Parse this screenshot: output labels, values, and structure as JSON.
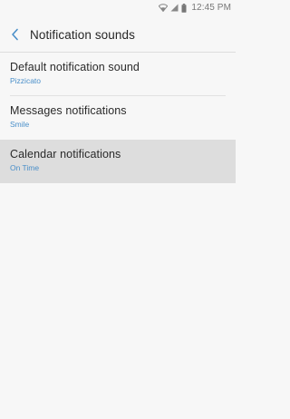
{
  "status_bar": {
    "time": "12:45 PM",
    "icons": [
      "wifi-icon",
      "signal-icon",
      "battery-icon"
    ]
  },
  "header": {
    "back_icon": "chevron-left-icon",
    "title": "Notification sounds"
  },
  "colors": {
    "accent": "#4a8fc9",
    "selected_bg": "#dddddd",
    "background": "#f7f7f7"
  },
  "items": [
    {
      "title": "Default notification sound",
      "value": "Pizzicato"
    },
    {
      "title": "Messages notifications",
      "value": "Smile"
    },
    {
      "title": "Calendar notifications",
      "value": "On Time"
    }
  ]
}
